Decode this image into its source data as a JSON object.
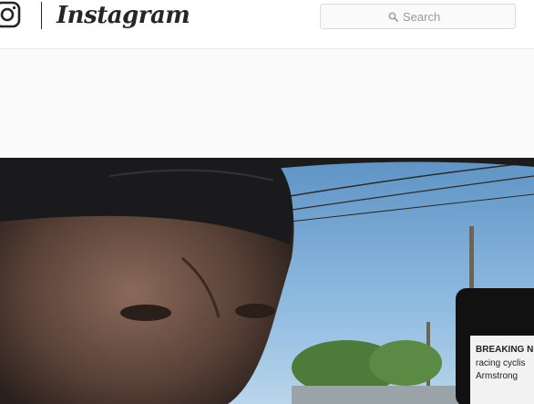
{
  "app": {
    "brand": "Instagram"
  },
  "search": {
    "placeholder": "Search"
  },
  "icons": {
    "logo": "camera-icon",
    "search": "search-icon"
  },
  "media": {
    "phone_screen_text": [
      "BREAKING N",
      "racing cyclis",
      "Armstrong "
    ]
  },
  "colors": {
    "text": "#262626",
    "border": "#dbdbdb",
    "page_bg": "#fafafa",
    "placeholder": "#999999"
  }
}
